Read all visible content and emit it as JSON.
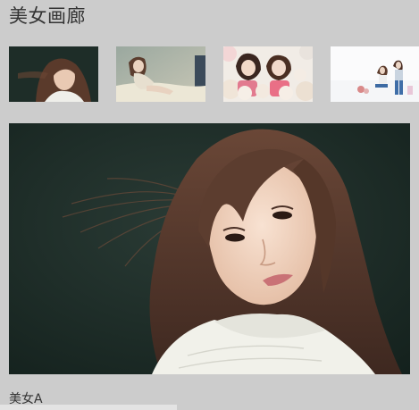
{
  "header": {
    "title": "美女画廊"
  },
  "gallery": {
    "thumbnails": [
      {
        "name": "thumb-1",
        "subject": "woman-hair-blowing"
      },
      {
        "name": "thumb-2",
        "subject": "woman-seated-bed"
      },
      {
        "name": "thumb-3",
        "subject": "two-women-teddy-bears"
      },
      {
        "name": "thumb-4",
        "subject": "two-women-white-room"
      }
    ],
    "main_caption": "美女A"
  },
  "colors": {
    "page_background": "#cccccc",
    "text": "#333333",
    "photo_background": "#1d2c27"
  }
}
